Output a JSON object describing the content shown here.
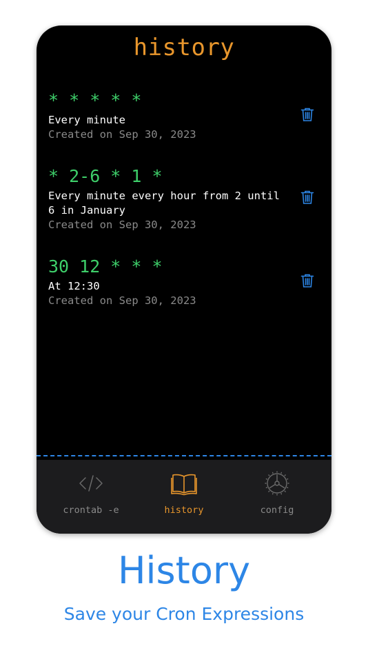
{
  "screen": {
    "title": "history"
  },
  "history": [
    {
      "expression": "* * * * *",
      "description": "Every minute",
      "created": "Created on Sep 30, 2023"
    },
    {
      "expression": "* 2-6 * 1 *",
      "description": "Every minute every hour from 2 until 6 in January",
      "created": "Created on Sep 30, 2023"
    },
    {
      "expression": "30 12 * * *",
      "description": "At 12:30",
      "created": "Created on Sep 30, 2023"
    }
  ],
  "tabbar": {
    "tabs": [
      {
        "label": "crontab -e",
        "icon": "code-icon",
        "active": false
      },
      {
        "label": "history",
        "icon": "book-icon",
        "active": true
      },
      {
        "label": "config",
        "icon": "gear-icon",
        "active": false
      }
    ]
  },
  "promo": {
    "headline": "History",
    "subtitle": "Save your Cron Expressions"
  },
  "colors": {
    "accent_orange": "#e8962c",
    "cron_green": "#3ecf6a",
    "link_blue": "#2d86e6",
    "muted_gray": "#8a8a8a"
  }
}
